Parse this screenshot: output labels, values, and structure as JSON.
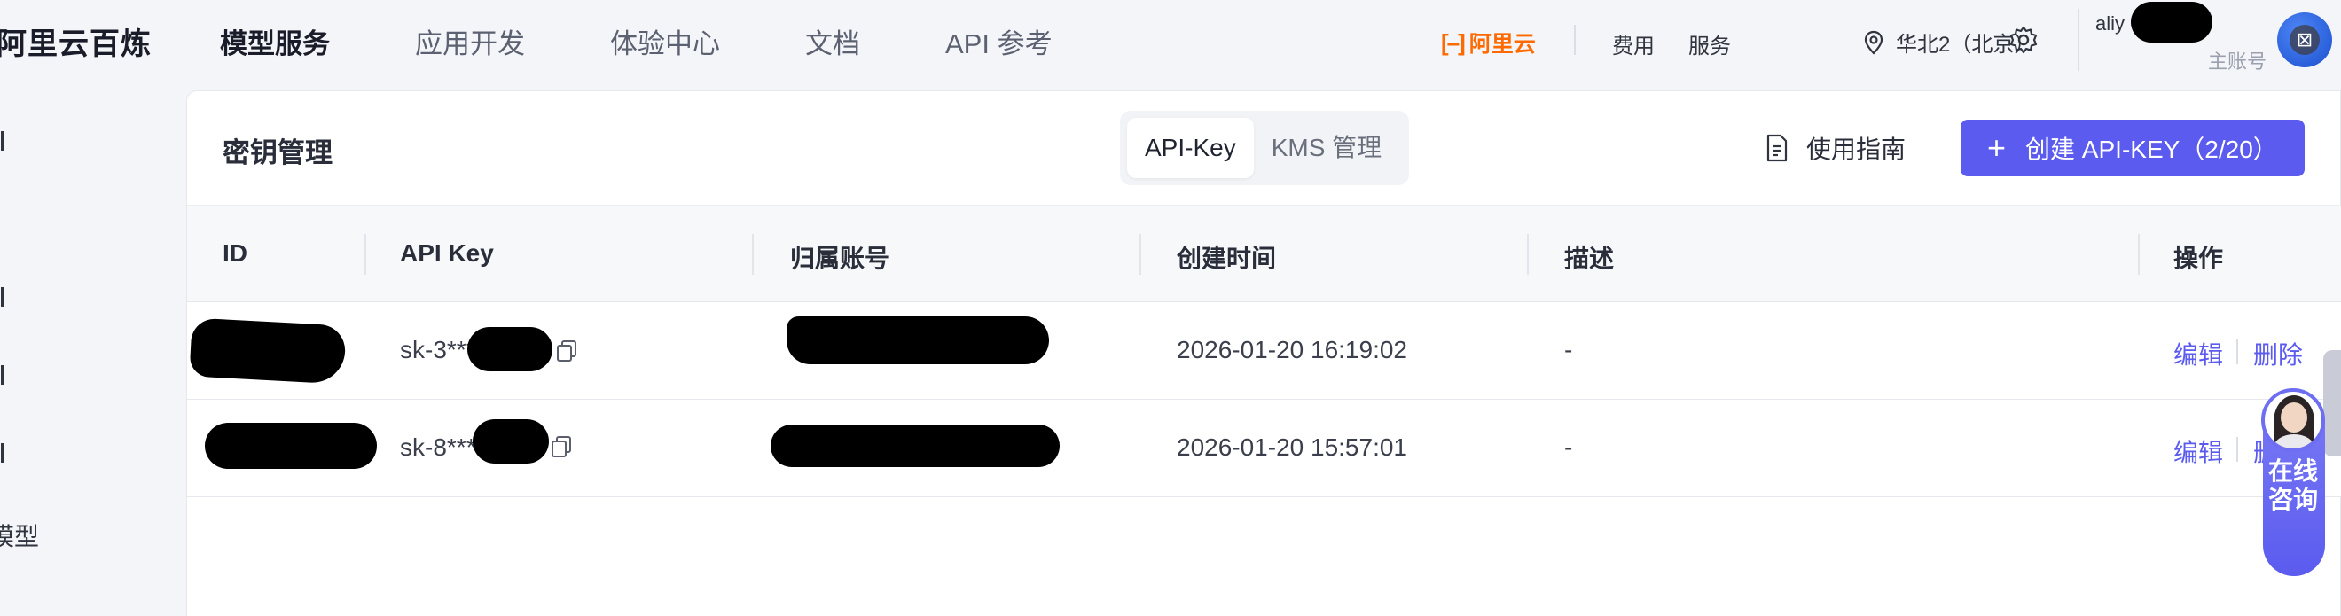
{
  "brand": "阿里云百炼",
  "nav": {
    "tabs": [
      "模型服务",
      "应用开发",
      "体验中心",
      "文档",
      "API 参考"
    ],
    "active_index": 0
  },
  "topbar": {
    "aliyun_logo": "阿里云",
    "fee": "费用",
    "service": "服务",
    "region": "华北2（北京）",
    "user_prefix": "aliy",
    "user_sub": "主账号"
  },
  "sidebar": {
    "fragments": [
      "",
      "",
      "",
      "",
      "模型"
    ]
  },
  "card": {
    "title": "密钥管理",
    "segments": [
      "API-Key",
      "KMS 管理"
    ],
    "active_segment": 0,
    "guide_label": "使用指南",
    "create_label": "创建 API-KEY（2/20）"
  },
  "table": {
    "columns": [
      "ID",
      "API Key",
      "归属账号",
      "创建时间",
      "描述",
      "操作"
    ],
    "rows": [
      {
        "api_key": "sk-3***",
        "created": "2026-01-20 16:19:02",
        "desc": "-",
        "edit": "编辑",
        "delete": "删除"
      },
      {
        "api_key": "sk-8***",
        "created": "2026-01-20 15:57:01",
        "desc": "-",
        "edit": "编辑",
        "delete": "删除"
      }
    ]
  },
  "consult": {
    "label": "在线咨询"
  },
  "colors": {
    "accent": "#5b5bef",
    "aliyun_orange": "#ff6a00",
    "background": "#f4f5f9"
  }
}
